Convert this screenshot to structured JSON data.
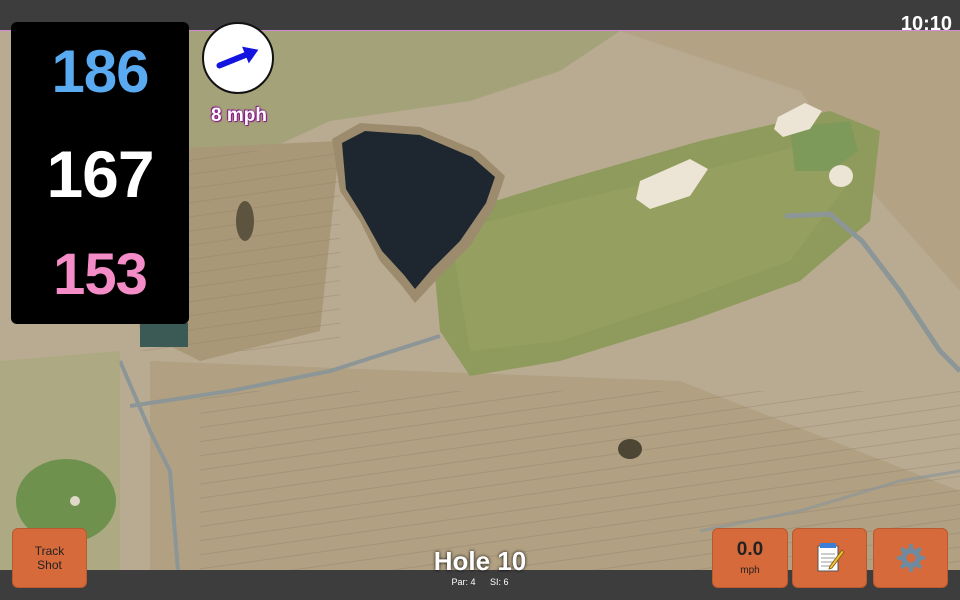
{
  "status": {
    "time": "10:10"
  },
  "distances": {
    "back": "186",
    "middle": "167",
    "front": "153",
    "back_color": "#5aaaf2",
    "middle_color": "#ffffff",
    "front_color": "#f48cc8"
  },
  "wind": {
    "speed": "8 mph",
    "arrow_icon": "arrow-right-icon"
  },
  "hole": {
    "title": "Hole 10",
    "par": "Par: 4",
    "stroke_index": "SI: 6"
  },
  "buttons": {
    "track_line1": "Track",
    "track_line2": "Shot",
    "speed_value": "0.0",
    "speed_unit": "mph",
    "notes_icon": "notepad-icon",
    "settings_icon": "gear-icon",
    "button_color": "#d76a3a"
  }
}
